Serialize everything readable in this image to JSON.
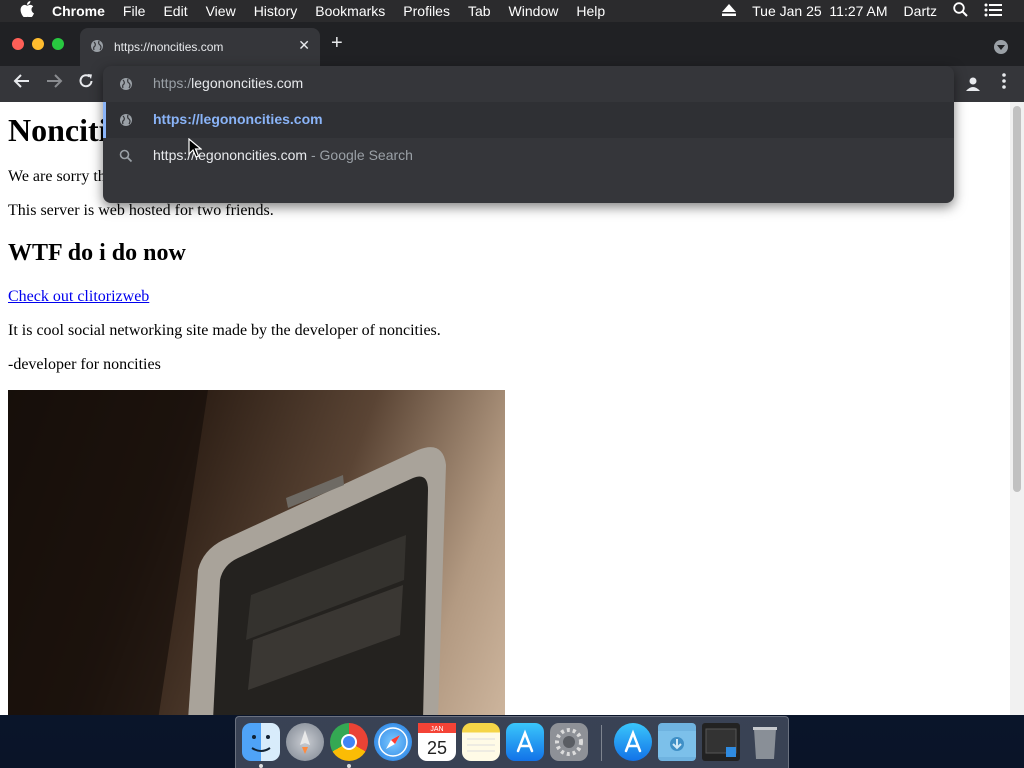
{
  "menubar": {
    "app_name": "Chrome",
    "menus": [
      "File",
      "Edit",
      "View",
      "History",
      "Bookmarks",
      "Profiles",
      "Tab",
      "Window",
      "Help"
    ],
    "datetime": "Tue Jan 25  11:27 AM",
    "user": "Dartz"
  },
  "tab": {
    "title": "https://noncities.com"
  },
  "omnibox": {
    "input_prefix": "https:/",
    "input_typed": "legononcities.com",
    "suggestion_url": "https://legononcities.com",
    "search_query": "https://legononcities.com",
    "search_suffix": "- Google Search"
  },
  "page": {
    "heading": "Noncities",
    "para1": "We are sorry that it is closed.",
    "para2": "This server is web hosted for two friends.",
    "subheading": "WTF do i do now",
    "link": "Check out clitorizweb",
    "para3": "It is cool social networking site made by the developer of noncities.",
    "signature": "-developer for noncities"
  },
  "dock": {
    "items": [
      "finder-icon",
      "launchpad-icon",
      "chrome-icon",
      "safari-icon",
      "calendar-icon",
      "notes-icon",
      "app-store-icon",
      "system-preferences-icon",
      "app-store-folder-icon",
      "downloads-folder-icon",
      "screenshot-icon",
      "trash-icon"
    ],
    "calendar_month": "JAN",
    "calendar_day": "25"
  }
}
